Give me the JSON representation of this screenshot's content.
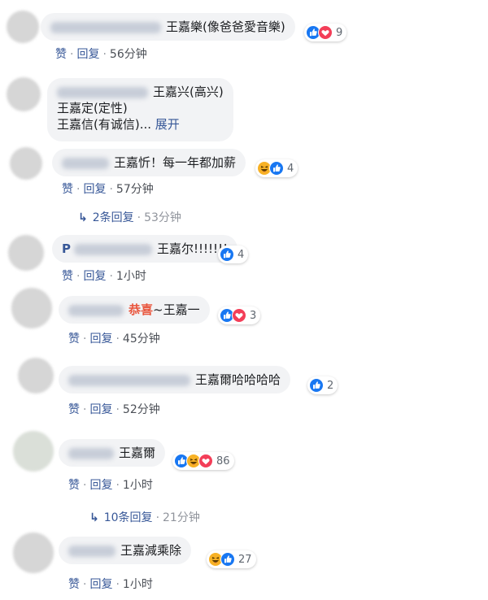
{
  "colors": {
    "like": "#1877f2",
    "love": "#f33e58",
    "haha": "#f7b125",
    "link": "#385898"
  },
  "action_sep": "·",
  "comments": [
    {
      "text": "王嘉樂(像爸爸愛音樂)",
      "reactions": [
        "like",
        "love"
      ],
      "count": "9",
      "actions": {
        "like": "赞",
        "reply": "回复",
        "time": "56分钟"
      }
    },
    {
      "partial_name": "王嘉兴(高兴)",
      "lines": [
        "王嘉定(定性)",
        "王嘉信(有诚信)..."
      ],
      "see_more": "展开"
    },
    {
      "text": "王嘉忻！每一年都加薪",
      "reactions": [
        "haha",
        "like"
      ],
      "count": "4",
      "actions": {
        "like": "赞",
        "reply": "回复",
        "time": "57分钟"
      },
      "replies": {
        "label": "2条回复",
        "time": "53分钟"
      }
    },
    {
      "name_prefix": "P",
      "text": "王嘉尔!!!!!!!",
      "reactions": [
        "like"
      ],
      "count": "4",
      "actions": {
        "like": "赞",
        "reply": "回复",
        "time": "1小时"
      }
    },
    {
      "highlight": "恭喜",
      "text": "~王嘉一",
      "reactions": [
        "like",
        "love"
      ],
      "count": "3",
      "actions": {
        "like": "赞",
        "reply": "回复",
        "time": "45分钟"
      }
    },
    {
      "text": "王嘉爾哈哈哈哈",
      "reactions": [
        "like"
      ],
      "count": "2",
      "actions": {
        "like": "赞",
        "reply": "回复",
        "time": "52分钟"
      }
    },
    {
      "text": "王嘉爾",
      "reactions": [
        "like",
        "haha",
        "love"
      ],
      "count": "86",
      "actions": {
        "like": "赞",
        "reply": "回复",
        "time": "1小时"
      },
      "replies": {
        "label": "10条回复",
        "time": "21分钟"
      }
    },
    {
      "text": "王嘉減乘除",
      "reactions": [
        "haha",
        "like"
      ],
      "count": "27",
      "actions": {
        "like": "赞",
        "reply": "回复",
        "time": "1小时"
      }
    }
  ]
}
